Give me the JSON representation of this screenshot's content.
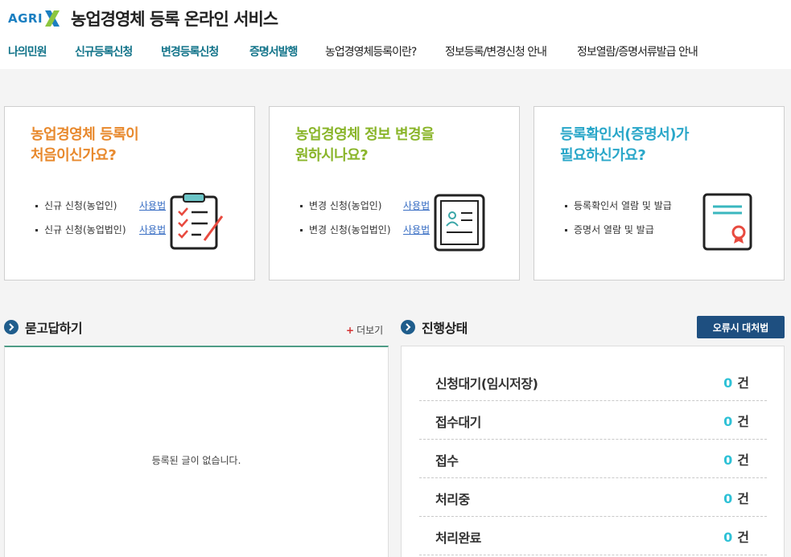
{
  "header": {
    "logo_text": "AGRI",
    "title": "농업경영체 등록 온라인 서비스"
  },
  "nav": [
    {
      "label": "나의민원",
      "type": "primary"
    },
    {
      "label": "신규등록신청",
      "type": "primary"
    },
    {
      "label": "변경등록신청",
      "type": "primary"
    },
    {
      "label": "증명서발행",
      "type": "primary"
    },
    {
      "label": "농업경영체등록이란?",
      "type": "secondary"
    },
    {
      "label": "정보등록/변경신청 안내",
      "type": "secondary"
    },
    {
      "label": "정보열람/증명서류발급 안내",
      "type": "secondary"
    }
  ],
  "cards": [
    {
      "title_line1": "농업경영체 등록이",
      "title_line2": "처음이신가요?",
      "color": "#e8892d",
      "items": [
        "신규 신청(농업인)",
        "신규 신청(농업법인)"
      ],
      "howto": "사용법",
      "icon": "clipboard-checklist-icon"
    },
    {
      "title_line1": "농업경영체 정보 변경을",
      "title_line2": "원하시나요?",
      "color": "#8ab52a",
      "items": [
        "변경 신청(농업인)",
        "변경 신청(농업법인)"
      ],
      "howto": "사용법",
      "icon": "profile-document-icon"
    },
    {
      "title_line1": "등록확인서(증명서)가",
      "title_line2": "필요하신가요?",
      "color": "#2aa7c9",
      "items": [
        "등록확인서 열람 및 발급",
        "증명서 열람 및 발급"
      ],
      "icon": "certificate-icon"
    }
  ],
  "qa": {
    "title": "묻고답하기",
    "more": "더보기",
    "empty_message": "등록된 글이 없습니다."
  },
  "status": {
    "title": "진행상태",
    "error_button": "오류시 대처법",
    "unit": "건",
    "rows": [
      {
        "label": "신청대기(임시저장)",
        "count": "0"
      },
      {
        "label": "접수대기",
        "count": "0"
      },
      {
        "label": "접수",
        "count": "0"
      },
      {
        "label": "처리중",
        "count": "0"
      },
      {
        "label": "처리완료",
        "count": "0"
      }
    ]
  },
  "colors": {
    "nav_primary": "#13748a",
    "accent_blue": "#1e4f80",
    "count_cyan": "#2ec1d6",
    "qa_border": "#4e9c86"
  }
}
